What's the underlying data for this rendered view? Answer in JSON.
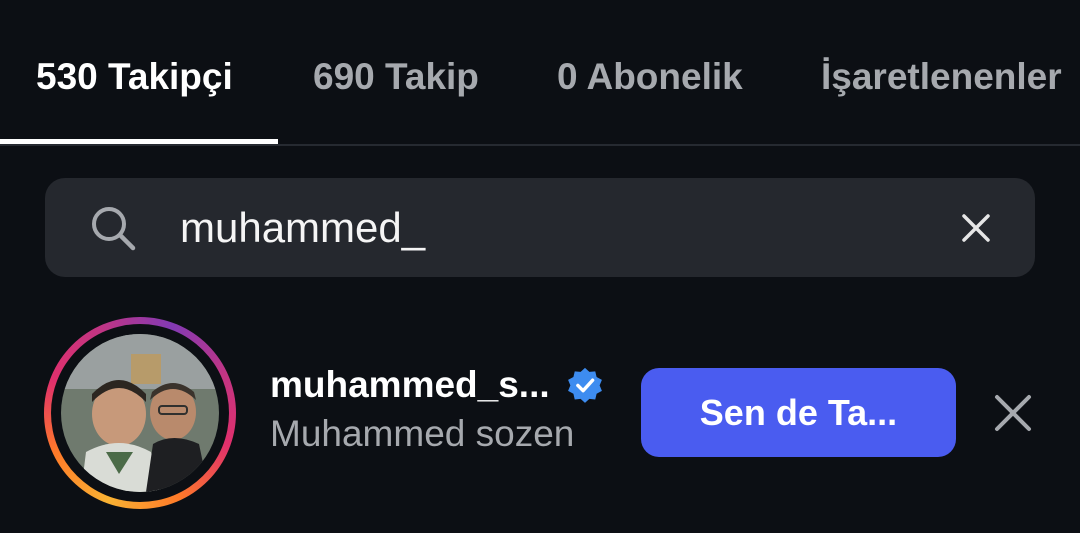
{
  "tabs": [
    {
      "label": "530 Takipçi",
      "active": true
    },
    {
      "label": "690 Takip",
      "active": false
    },
    {
      "label": "0 Abonelik",
      "active": false
    },
    {
      "label": "İşaretlenenler",
      "active": false
    }
  ],
  "search": {
    "value": "muhammed_",
    "icon": "search-icon",
    "clear_icon": "close-icon"
  },
  "results": [
    {
      "username": "muhammed_s...",
      "full_name": "Muhammed sozen",
      "verified": true,
      "follow_button_label": "Sen de Ta...",
      "remove_icon": "close-icon",
      "story_ring": true
    }
  ],
  "colors": {
    "background": "#0c0f14",
    "search_bg": "#25282e",
    "button": "#4a5cf0",
    "verified": "#3d8cf0",
    "muted_text": "#a6a9ae"
  }
}
